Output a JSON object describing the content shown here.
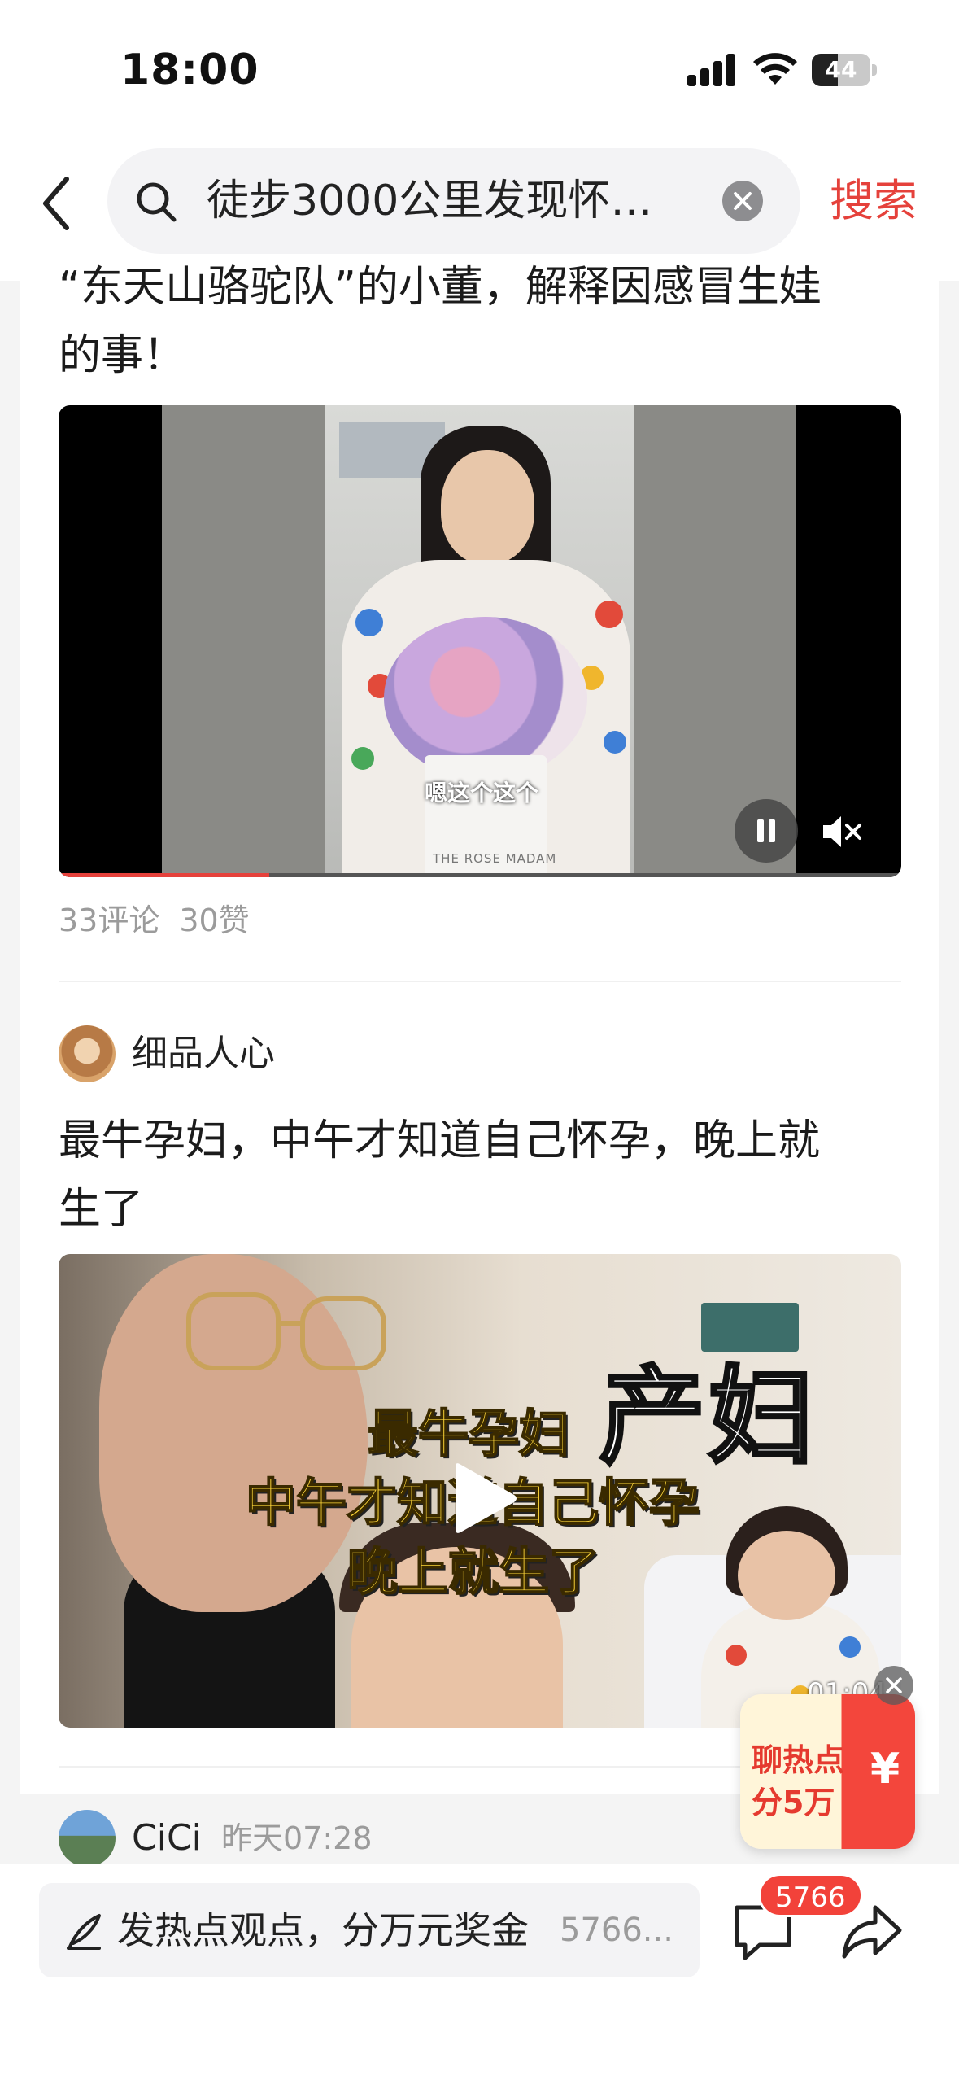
{
  "status_bar": {
    "time": "18:00",
    "battery": "44",
    "battery_level": 0.44
  },
  "search": {
    "query": "徒步3000公里发现怀…",
    "submit_label": "搜索"
  },
  "post1": {
    "title_lines": [
      "“东天山骆驼队”的小董，解释因感冒生娃",
      "的事！"
    ],
    "video_caption": "嗯这个这个",
    "video_brand": "THE ROSE MADAM",
    "progress": 0.25,
    "comments": "33评论",
    "likes": "30赞"
  },
  "post2": {
    "author": "细品人心",
    "title_lines": [
      "最牛孕妇，中午才知道自己怀孕，晚上就",
      "生了"
    ],
    "overlay_big": "产妇",
    "overlay_lines": [
      "最牛孕妇",
      "中午才知道自己怀孕",
      "晚上就生了"
    ],
    "duration": "01:04"
  },
  "post3": {
    "author": "CiCi",
    "time": "昨天07:28"
  },
  "promo": {
    "line1": "聊热点",
    "line2": "分5万",
    "symbol": "¥"
  },
  "bottom_bar": {
    "placeholder": "发热点观点，分万元奖金",
    "count_text": "5766...",
    "badge": "5766"
  },
  "colors": {
    "accent": "#e5413b",
    "muted_text": "#9b9b9b"
  }
}
